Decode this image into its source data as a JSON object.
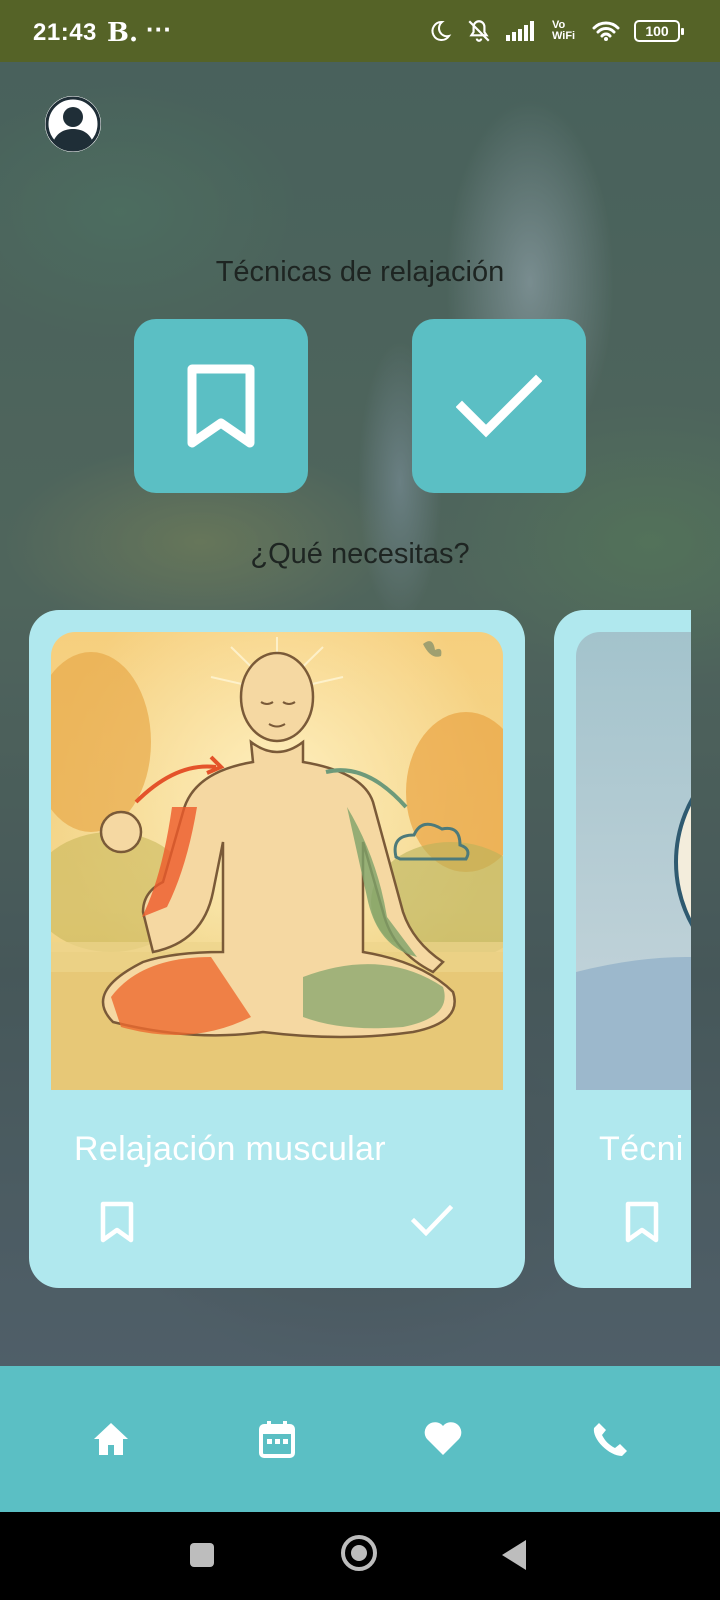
{
  "status_bar": {
    "time": "21:43",
    "carrier_badge": "B.",
    "more": "···",
    "vo_wifi": "Vo WiFi",
    "battery": "100"
  },
  "header": {
    "avatar_icon": "account-circle-icon"
  },
  "techniques": {
    "title": "Técnicas de relajación",
    "saved_icon": "bookmark-icon",
    "done_icon": "check-icon"
  },
  "needs": {
    "title": "¿Qué necesitas?",
    "cards": [
      {
        "title": "Relajación muscular",
        "bookmark_icon": "bookmark-icon",
        "check_icon": "check-icon"
      },
      {
        "title": "Técni",
        "bookmark_icon": "bookmark-icon"
      }
    ]
  },
  "bottom_nav": {
    "items": [
      {
        "icon": "home-icon"
      },
      {
        "icon": "calendar-icon"
      },
      {
        "icon": "heart-icon"
      },
      {
        "icon": "phone-icon"
      }
    ]
  },
  "colors": {
    "status_bar": "#556327",
    "accent": "#5bbfc4",
    "card_bg": "#b0e8ee",
    "title_text": "#1e2522"
  }
}
